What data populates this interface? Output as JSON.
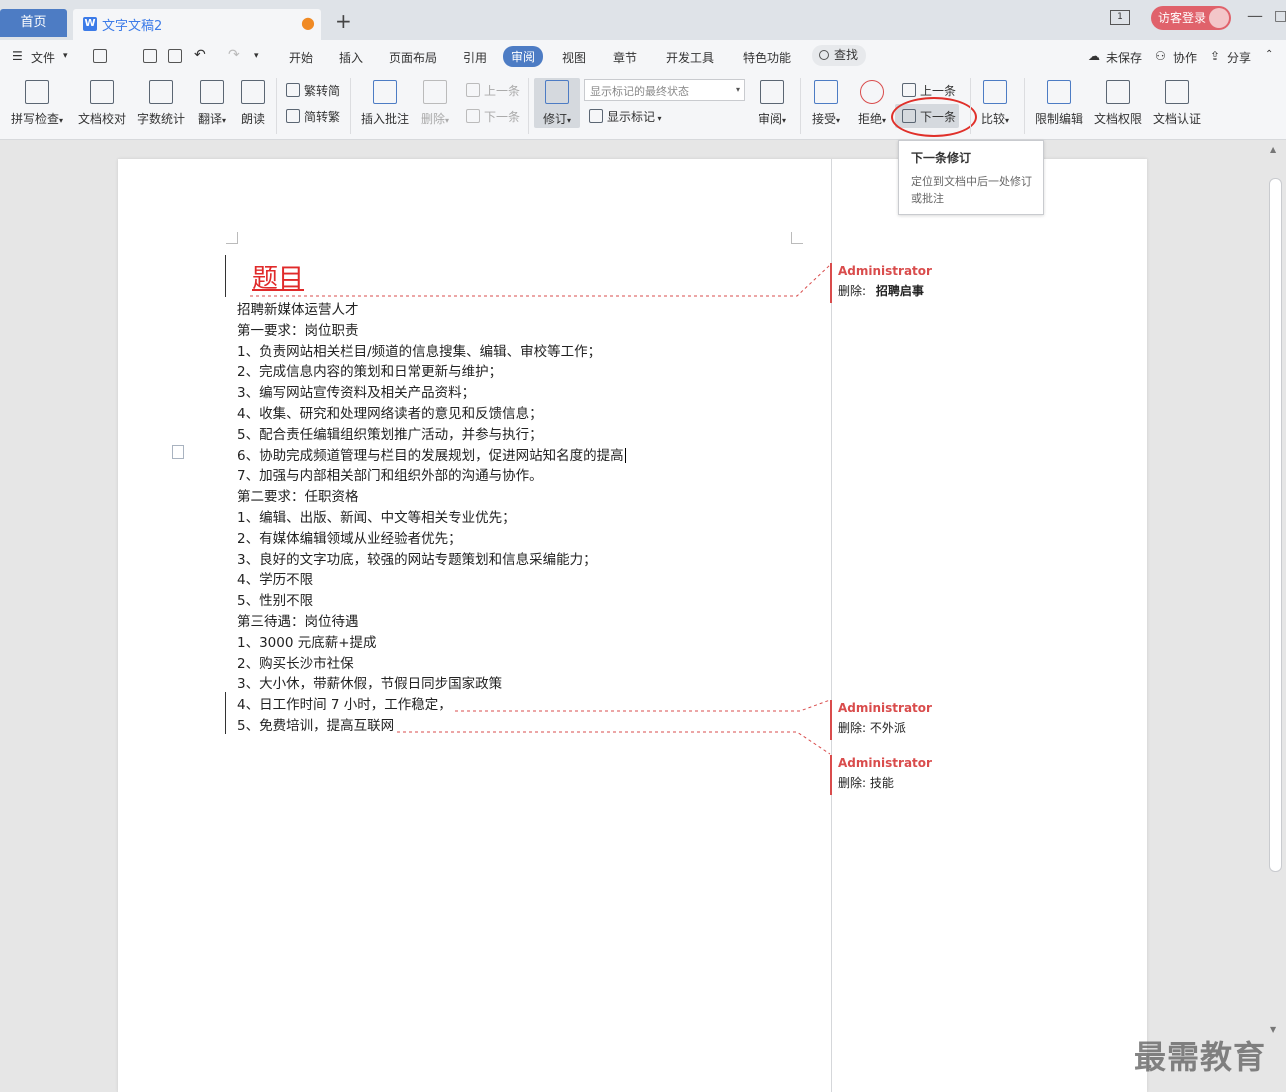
{
  "titlebar": {
    "home_tab": "首页",
    "doc_tab": "文字文稿2",
    "add_tab": "+",
    "screen_label": "1",
    "login": "访客登录",
    "minimize": "—",
    "maximize": "□"
  },
  "menu": {
    "file": "文件",
    "tabs": [
      "开始",
      "插入",
      "页面布局",
      "引用",
      "审阅",
      "视图",
      "章节",
      "开发工具",
      "特色功能"
    ],
    "active_tab": "审阅",
    "search": "查找",
    "unsaved": "未保存",
    "collab": "协作",
    "share": "分享"
  },
  "ribbon": {
    "spell_check": "拼写检查",
    "doc_proof": "文档校对",
    "word_count": "字数统计",
    "translate": "翻译",
    "read_aloud": "朗读",
    "trad_to_simp": "繁转简",
    "simp_to_trad": "简转繁",
    "insert_comment": "插入批注",
    "delete": "删除",
    "prev_comment": "上一条",
    "next_comment": "下一条",
    "revise": "修订",
    "markup_mode": "显示标记的最终状态",
    "show_markup": "显示标记",
    "review": "审阅",
    "accept": "接受",
    "reject": "拒绝",
    "prev_change": "上一条",
    "next_change": "下一条",
    "compare": "比较",
    "restrict_edit": "限制编辑",
    "doc_rights": "文档权限",
    "doc_auth": "文档认证"
  },
  "tooltip": {
    "title": "下一条修订",
    "desc": "定位到文档中后一处修订或批注"
  },
  "document": {
    "title": "题目",
    "lines": [
      "招聘新媒体运营人才",
      "第一要求：岗位职责",
      "1、负责网站相关栏目/频道的信息搜集、编辑、审校等工作；",
      "2、完成信息内容的策划和日常更新与维护；",
      "3、编写网站宣传资料及相关产品资料；",
      "4、收集、研究和处理网络读者的意见和反馈信息；",
      "5、配合责任编辑组织策划推广活动，并参与执行；",
      "6、协助完成频道管理与栏目的发展规划，促进网站知名度的提高",
      "7、加强与内部相关部门和组织外部的沟通与协作。",
      "第二要求：任职资格",
      "1、编辑、出版、新闻、中文等相关专业优先；",
      "2、有媒体编辑领域从业经验者优先；",
      "3、良好的文字功底，较强的网站专题策划和信息采编能力；",
      "4、学历不限",
      "5、性别不限",
      "第三待遇：岗位待遇",
      "1、3000 元底薪+提成",
      "2、购买长沙市社保",
      "3、大小休，带薪休假，节假日同步国家政策",
      "4、日工作时间 7 小时，工作稳定，",
      "5、免费培训，提高互联网"
    ]
  },
  "comments": [
    {
      "author": "Administrator",
      "label": "删除:",
      "text": "招聘启事"
    },
    {
      "author": "Administrator",
      "label": "删除:",
      "text": "不外派"
    },
    {
      "author": "Administrator",
      "label": "删除:",
      "text": "技能"
    }
  ],
  "watermark": "最需教育",
  "colors": {
    "accent": "#4d7cc4",
    "revision_red": "#d94c4c",
    "highlight_circle": "#e0302a"
  }
}
